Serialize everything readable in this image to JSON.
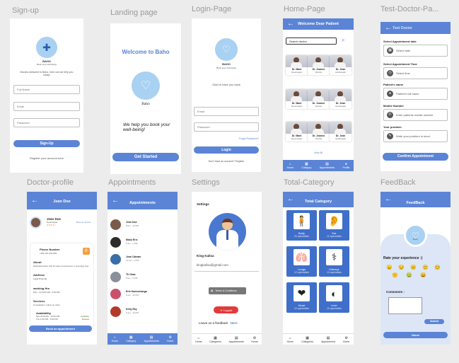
{
  "colors": {
    "primary": "#5b84d6",
    "canvas": "#ececec",
    "feedback_bg": "#dde6f7"
  },
  "frame_labels": {
    "signup": "Sign-up",
    "landing": "Landing page",
    "login": "Login-Page",
    "home": "Home-Page",
    "test": "Test-Doctor-Pa...",
    "profile": "Doctor-profile",
    "appointments": "Appointments",
    "settings": "Settings",
    "category": "Total-Category",
    "feedback": "FeedBack"
  },
  "brand": {
    "name": "BAHO",
    "tagline": "Book your well-being",
    "landing_name": "Baho",
    "feedback_name": "Baho"
  },
  "signup": {
    "intro": "Muraho welcome to Baho, here can we help you today!",
    "fields": [
      "Full Name",
      "Email",
      "Password"
    ],
    "button": "Sign-Up",
    "footer": "Register your account here"
  },
  "landing": {
    "welcome": "Welcome to Baho",
    "slogan": "We help you book your well-being!",
    "button": "Get Started"
  },
  "login": {
    "intro": "Glad to have you back",
    "fields": [
      "Email",
      "Password"
    ],
    "forgot": "Forget Password?",
    "button": "Login",
    "footer": "Don't have an account? Register"
  },
  "home": {
    "title": "Welcome Dear Patient",
    "search_placeholder": "Search doctor",
    "doctors": [
      {
        "name": "Dr. Mani",
        "spec": "Neurologist"
      },
      {
        "name": "Dr. Jeanne",
        "spec": "Dentist"
      },
      {
        "name": "Dr. Jean",
        "spec": "cardiologist"
      },
      {
        "name": "Dr. Mani",
        "spec": "Neurologist"
      },
      {
        "name": "Dr. Jeanne",
        "spec": "Dentist"
      },
      {
        "name": "Dr. Jean",
        "spec": "cardiologist"
      },
      {
        "name": "Dr. Mani",
        "spec": "Neurologist"
      },
      {
        "name": "Dr. Jeanne",
        "spec": "Dentist"
      },
      {
        "name": "Dr. Jean",
        "spec": "cardiologist"
      }
    ],
    "view_all": "View All"
  },
  "nav": {
    "home": "Home",
    "category": "Category",
    "appointments": "Appointments",
    "profile": "Profile",
    "categories": "Categories",
    "appointment": "Appointment"
  },
  "test": {
    "title": "Test Doctor",
    "sections": [
      {
        "label": "Select Appointment date",
        "value": "Select date",
        "icon": "▦"
      },
      {
        "label": "Select Appointment Time",
        "value": "Select time",
        "icon": "◷"
      },
      {
        "label": "Patient's name",
        "value": "Patient's full name",
        "icon": "●"
      },
      {
        "label": "Mobile Number",
        "value": "Enter patients mobile number",
        "icon": "✆"
      },
      {
        "label": "Your problem",
        "value": "Write your problem in short",
        "icon": "✎"
      }
    ],
    "button": "Confirm Appointment"
  },
  "profile": {
    "title": "Jean Doe",
    "name": "Jean Doe",
    "role": "Neurologist",
    "rating": "★★★★☆",
    "book_link": "Book an Doctor",
    "phone_label": "Phone Number",
    "phone": "+250 787 000 000",
    "about_label": "About",
    "about": "Dedicated doctor with 10 years of experience in neurology care.",
    "address_label": "Address",
    "address": "Kigali Rwanda",
    "hours_label": "working Hrs",
    "hours": "Mon - Fri 8:00 AM - 5:00 PM",
    "services_label": "Services",
    "services": "Consultation, follow up visits",
    "avail_label": "Availability",
    "avail_rows": [
      "Mon 8:00 AM - 12:00 PM",
      "Tue 1:00 PM - 5:00 PM"
    ],
    "avail_status": [
      "Available",
      "Booked"
    ],
    "button": "Book an appointment"
  },
  "appointments": {
    "title": "Appointments",
    "items": [
      {
        "name": "Jean Doe",
        "time": "8 am - 12 PM",
        "color": "#7a5a48"
      },
      {
        "name": "Mako Eric",
        "time": "9 am - 1 PM",
        "color": "#2b2b2b"
      },
      {
        "name": "Jean Caleam",
        "time": "10 am - 2 PM",
        "color": "#3a6ea8"
      },
      {
        "name": "Tli Okas",
        "time": "8 am - 5 PM",
        "color": "#8a8f9a"
      },
      {
        "name": "Erin Kamushanga",
        "time": "8 am - 12 PM",
        "color": "#c9526a"
      },
      {
        "name": "Kelly Eky",
        "time": "9 am - 12 PM",
        "color": "#b23a2a"
      }
    ]
  },
  "settings": {
    "title": "Settings",
    "username": "King Kalisa",
    "email": "kingkalisa@gmail.com",
    "terms": "Terms & Conditions",
    "logout": "Logout",
    "feedback_text": "Leave us a feedback",
    "feedback_link": "Here"
  },
  "category": {
    "title": "Total Category",
    "items": [
      {
        "name": "Body",
        "count": "20 specialists",
        "icon": "🧍"
      },
      {
        "name": "Ear",
        "count": "12 specialists",
        "icon": "👂"
      },
      {
        "name": "Lungs",
        "count": "12 specialists",
        "icon": "🫁"
      },
      {
        "name": "Kidneys",
        "count": "10 specialists",
        "icon": "⚕"
      },
      {
        "name": "Heart",
        "count": "12 specialists",
        "icon": "❤"
      },
      {
        "name": "Liver",
        "count": "10 specialists",
        "icon": "◐"
      }
    ]
  },
  "feedback": {
    "title": "FeedBack",
    "rate_label": "Rate your experience :)",
    "emojis": [
      "😠",
      "😒",
      "😐",
      "🙂",
      "😊",
      "🙁",
      "🤢",
      "😀"
    ],
    "comments_label": "Comments :",
    "submit": "Submit",
    "home": "Home"
  }
}
